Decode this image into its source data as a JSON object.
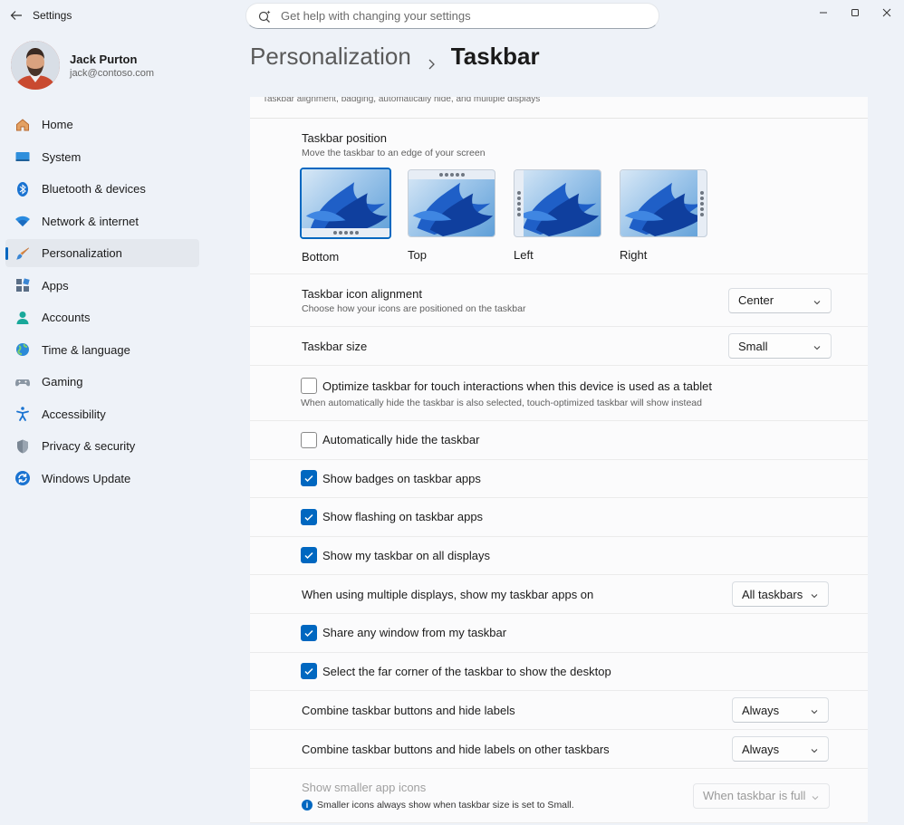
{
  "app": {
    "title": "Settings"
  },
  "search": {
    "placeholder": "Get help with changing your settings"
  },
  "user": {
    "name": "Jack Purton",
    "email": "jack@contoso.com"
  },
  "sidebar": {
    "items": [
      {
        "label": "Home",
        "icon": "home-icon"
      },
      {
        "label": "System",
        "icon": "system-icon"
      },
      {
        "label": "Bluetooth & devices",
        "icon": "bluetooth-icon"
      },
      {
        "label": "Network & internet",
        "icon": "wifi-icon"
      },
      {
        "label": "Personalization",
        "icon": "brush-icon",
        "active": true
      },
      {
        "label": "Apps",
        "icon": "apps-icon"
      },
      {
        "label": "Accounts",
        "icon": "person-icon"
      },
      {
        "label": "Time & language",
        "icon": "globe-icon"
      },
      {
        "label": "Gaming",
        "icon": "gamepad-icon"
      },
      {
        "label": "Accessibility",
        "icon": "accessibility-icon"
      },
      {
        "label": "Privacy & security",
        "icon": "shield-icon"
      },
      {
        "label": "Windows Update",
        "icon": "update-icon"
      }
    ]
  },
  "header": {
    "parent": "Personalization",
    "current": "Taskbar"
  },
  "cut_text": "Taskbar alignment, badging, automatically hide, and multiple displays",
  "position": {
    "title": "Taskbar position",
    "subtitle": "Move the taskbar to an edge of your screen",
    "options": [
      {
        "label": "Bottom",
        "selected": true
      },
      {
        "label": "Top"
      },
      {
        "label": "Left"
      },
      {
        "label": "Right"
      }
    ]
  },
  "alignment": {
    "title": "Taskbar icon alignment",
    "subtitle": "Choose how your icons are positioned on the taskbar",
    "value": "Center"
  },
  "size": {
    "title": "Taskbar size",
    "value": "Small"
  },
  "touch": {
    "label": "Optimize taskbar for touch interactions when this device is used as a tablet",
    "subtitle": "When automatically hide the taskbar is also selected, touch-optimized taskbar will show instead",
    "checked": false
  },
  "checks": {
    "autohide": {
      "label": "Automatically hide the taskbar",
      "checked": false
    },
    "badges": {
      "label": "Show badges on taskbar apps",
      "checked": true
    },
    "flashing": {
      "label": "Show flashing on taskbar apps",
      "checked": true
    },
    "all_displays": {
      "label": "Show my taskbar on all displays",
      "checked": true
    },
    "share_window": {
      "label": "Share any window from my taskbar",
      "checked": true
    },
    "far_corner": {
      "label": "Select the far corner of the taskbar to show the desktop",
      "checked": true
    }
  },
  "multi_display": {
    "title": "When using multiple displays, show my taskbar apps on",
    "value": "All taskbars"
  },
  "combine": {
    "title": "Combine taskbar buttons and hide labels",
    "value": "Always"
  },
  "combine_other": {
    "title": "Combine taskbar buttons and hide labels on other taskbars",
    "value": "Always"
  },
  "smaller_icons": {
    "title": "Show smaller app icons",
    "info": "Smaller icons always show when taskbar size is set to Small.",
    "value": "When taskbar is full"
  },
  "colors": {
    "accent": "#0067c0",
    "background": "#eef2f8",
    "card": "#fbfbfc"
  }
}
